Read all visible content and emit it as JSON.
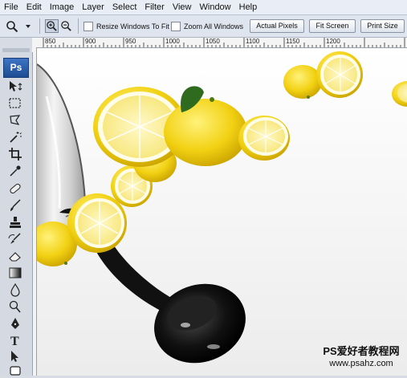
{
  "menu": [
    "File",
    "Edit",
    "Image",
    "Layer",
    "Select",
    "Filter",
    "View",
    "Window",
    "Help"
  ],
  "options": {
    "resize_windows": {
      "label": "Resize Windows To Fit",
      "checked": false
    },
    "zoom_all": {
      "label": "Zoom All Windows",
      "checked": false
    },
    "buttons": [
      "Actual Pixels",
      "Fit Screen",
      "Print Size"
    ]
  },
  "ruler": {
    "ticks": [
      "850",
      "900",
      "950",
      "1000",
      "1050",
      "1100",
      "1150",
      "1200"
    ]
  },
  "toolbox": {
    "logo": "Ps",
    "tools": [
      "move-tool",
      "marquee-tool",
      "lasso-tool",
      "magic-wand-tool",
      "crop-tool",
      "eyedropper-tool",
      "healing-brush-tool",
      "brush-tool",
      "clone-stamp-tool",
      "history-brush-tool",
      "eraser-tool",
      "gradient-tool",
      "blur-tool",
      "dodge-tool",
      "pen-tool",
      "type-tool",
      "path-selection-tool",
      "shape-tool"
    ]
  },
  "canvas": {
    "subject": "lemons and black wine glass"
  },
  "watermark": {
    "title": "PS爱好者教程网",
    "url": "www.psahz.com"
  },
  "colors": {
    "menubar": "#e9eef6",
    "toolbox": "#d4d9e2",
    "lemon": "#f5d514"
  }
}
